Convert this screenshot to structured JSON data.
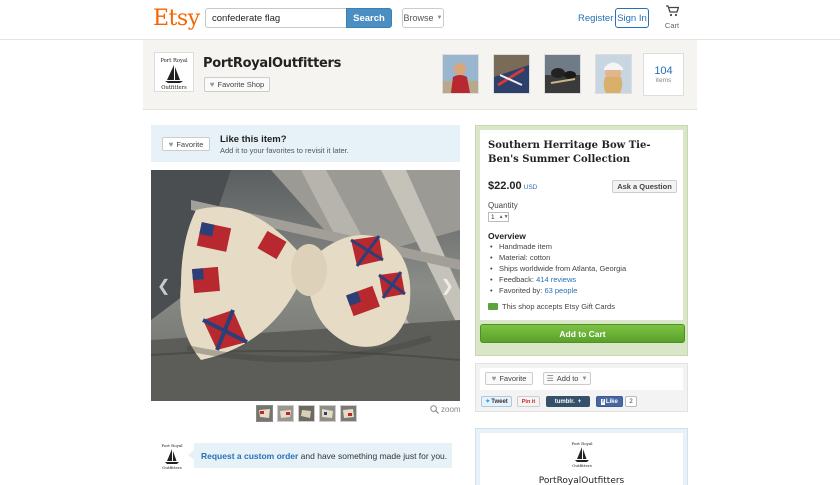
{
  "header": {
    "logo": "Etsy",
    "search_value": "confederate flag",
    "search_button": "Search",
    "browse": "Browse",
    "register": "Register",
    "sign_in": "Sign In",
    "cart": "Cart"
  },
  "shop": {
    "logo_line1": "Port Royal",
    "logo_line2": "Outfitters",
    "name": "PortRoyalOutfitters",
    "favorite_shop": "Favorite Shop",
    "items_count": "104",
    "items_label": "items"
  },
  "like_box": {
    "favorite": "Favorite",
    "title": "Like this item?",
    "subtitle": "Add it to your favorites to revisit it later."
  },
  "gallery": {
    "zoom": "zoom"
  },
  "custom_order": {
    "link": "Request a custom order",
    "rest": " and have something made just for you."
  },
  "listing": {
    "title": "Southern Herritage Bow Tie-Ben's Summer Collection",
    "price": "$22.00",
    "currency": "USD",
    "ask_question": "Ask a Question",
    "quantity_label": "Quantity",
    "quantity_value": "1",
    "overview_heading": "Overview",
    "overview": {
      "item1": "Handmade item",
      "item2": "Material: cotton",
      "item3": "Ships worldwide from Atlanta, Georgia",
      "feedback_prefix": "Feedback: ",
      "feedback_link": "414 reviews",
      "favorited_prefix": "Favorited by: ",
      "favorited_link": "63 people"
    },
    "gift_cards": "This shop accepts Etsy Gift Cards",
    "add_to_cart": "Add to Cart"
  },
  "share": {
    "favorite": "Favorite",
    "add_to": "Add to",
    "tweet": "Tweet",
    "pin_it": "Pin it",
    "tumblr": "tumblr.",
    "like": "Like",
    "like_count": "2"
  },
  "shop_card": {
    "name": "PortRoyalOutfitters"
  },
  "colors": {
    "etsy_orange": "#f56400",
    "link_blue": "#2770b7",
    "cart_green": "#5aa12c"
  }
}
